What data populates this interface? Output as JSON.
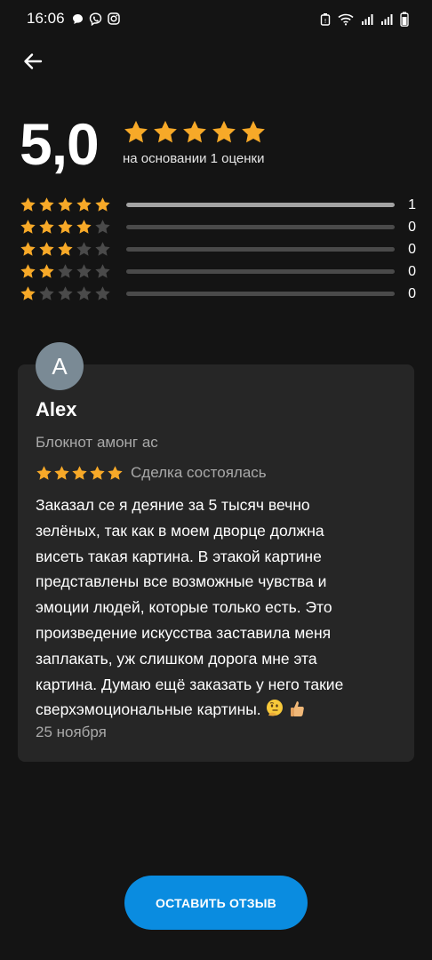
{
  "status_bar": {
    "time": "16:06",
    "left_icons": [
      "chat-bubble-icon",
      "viber-icon",
      "instagram-icon"
    ],
    "right_icons": [
      "alarm-icon",
      "wifi-icon",
      "signal-icon",
      "signal-icon",
      "battery-icon"
    ]
  },
  "header": {
    "average_rating": "5,0",
    "average_stars": 5,
    "caption": "на основании 1 оценки"
  },
  "histogram": [
    {
      "stars": 5,
      "count": "1",
      "fraction": 1.0
    },
    {
      "stars": 4,
      "count": "0",
      "fraction": 0.0
    },
    {
      "stars": 3,
      "count": "0",
      "fraction": 0.0
    },
    {
      "stars": 2,
      "count": "0",
      "fraction": 0.0
    },
    {
      "stars": 1,
      "count": "0",
      "fraction": 0.0
    }
  ],
  "review": {
    "avatar_letter": "A",
    "name": "Alex",
    "product": "Блокнот амонг ас",
    "stars": 5,
    "status": "Сделка состоялась",
    "text_lines": [
      "Заказал се я деяние за 5 тысяч вечно",
      "зелёных, так как в моем дворце должна",
      "висеть такая картина. В этакой картине",
      "представлены все возможные чувства и",
      "эмоции людей, которые только есть. Это",
      "произведение искусства заставила меня",
      "заплакать, уж слишком дорога мне эта",
      "картина. Думаю ещё заказать у него такие",
      "сверхэмоциональные картины."
    ],
    "emojis": [
      "thinking-face-icon",
      "thumbs-up-icon"
    ],
    "date": "25 ноября"
  },
  "actions": {
    "leave_review_label": "ОСТАВИТЬ ОТЗЫВ"
  },
  "colors": {
    "background": "#141414",
    "card": "#262626",
    "star_active": "#f7a928",
    "star_inactive": "#4a4a4a",
    "bar_fill": "#a3a3a3",
    "bar_track": "#4a4a4a",
    "button": "#0a8ce0",
    "muted_text": "#a9a9a9"
  }
}
